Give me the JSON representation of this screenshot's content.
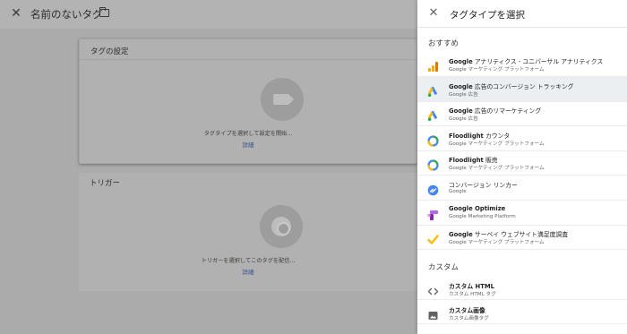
{
  "editor": {
    "title": "名前のないタグ",
    "tag_card": {
      "title": "タグの設定",
      "hint": "タグタイプを選択して設定を開始...",
      "more": "詳細"
    },
    "trigger_card": {
      "title": "トリガー",
      "hint": "トリガーを選択してこのタグを配信...",
      "more": "詳細"
    }
  },
  "panel": {
    "title": "タグタイプを選択",
    "sections": {
      "recommended": "おすすめ",
      "custom": "カスタム"
    },
    "items": [
      {
        "name_bold": "Google",
        "name_rest": " アナリティクス - ユニバーサル アナリティクス",
        "sub": "Google マーケティング プラットフォーム",
        "icon": "analytics-icon",
        "selected": false
      },
      {
        "name_bold": "Google",
        "name_rest": " 広告のコンバージョン トラッキング",
        "sub": "Google 広告",
        "icon": "google-ads-icon",
        "selected": true
      },
      {
        "name_bold": "Google",
        "name_rest": " 広告のリマーケティング",
        "sub": "Google 広告",
        "icon": "google-ads-icon",
        "selected": false
      },
      {
        "name_bold": "Floodlight",
        "name_rest": " カウンタ",
        "sub": "Google マーケティング プラットフォーム",
        "icon": "floodlight-icon",
        "selected": false
      },
      {
        "name_bold": "Floodlight",
        "name_rest": " 販売",
        "sub": "Google マーケティング プラットフォーム",
        "icon": "floodlight-icon",
        "selected": false
      },
      {
        "name_bold": "",
        "name_rest": "コンバージョン リンカー",
        "sub": "Google",
        "icon": "conversion-linker-icon",
        "selected": false
      },
      {
        "name_bold": "Google Optimize",
        "name_rest": "",
        "sub": "Google Marketing Platform",
        "icon": "optimize-icon",
        "selected": false
      },
      {
        "name_bold": "Google",
        "name_rest": " サーベイ ウェブサイト満足度調査",
        "sub": "Google マーケティング プラットフォーム",
        "icon": "surveys-icon",
        "selected": false
      }
    ],
    "custom_items": [
      {
        "name_bold": "カスタム HTML",
        "name_rest": "",
        "sub": "カスタム HTML タグ",
        "icon": "code-icon"
      },
      {
        "name_bold": "カスタム画像",
        "name_rest": "",
        "sub": "カスタム画像タグ",
        "icon": "image-icon"
      }
    ]
  },
  "colors": {
    "google_blue": "#4285f4",
    "google_yellow": "#fbbc04",
    "google_green": "#34a853",
    "analytics_orange": "#f9ab00",
    "optimize_purple": "#b366e6",
    "link_blue": "#34568b"
  }
}
